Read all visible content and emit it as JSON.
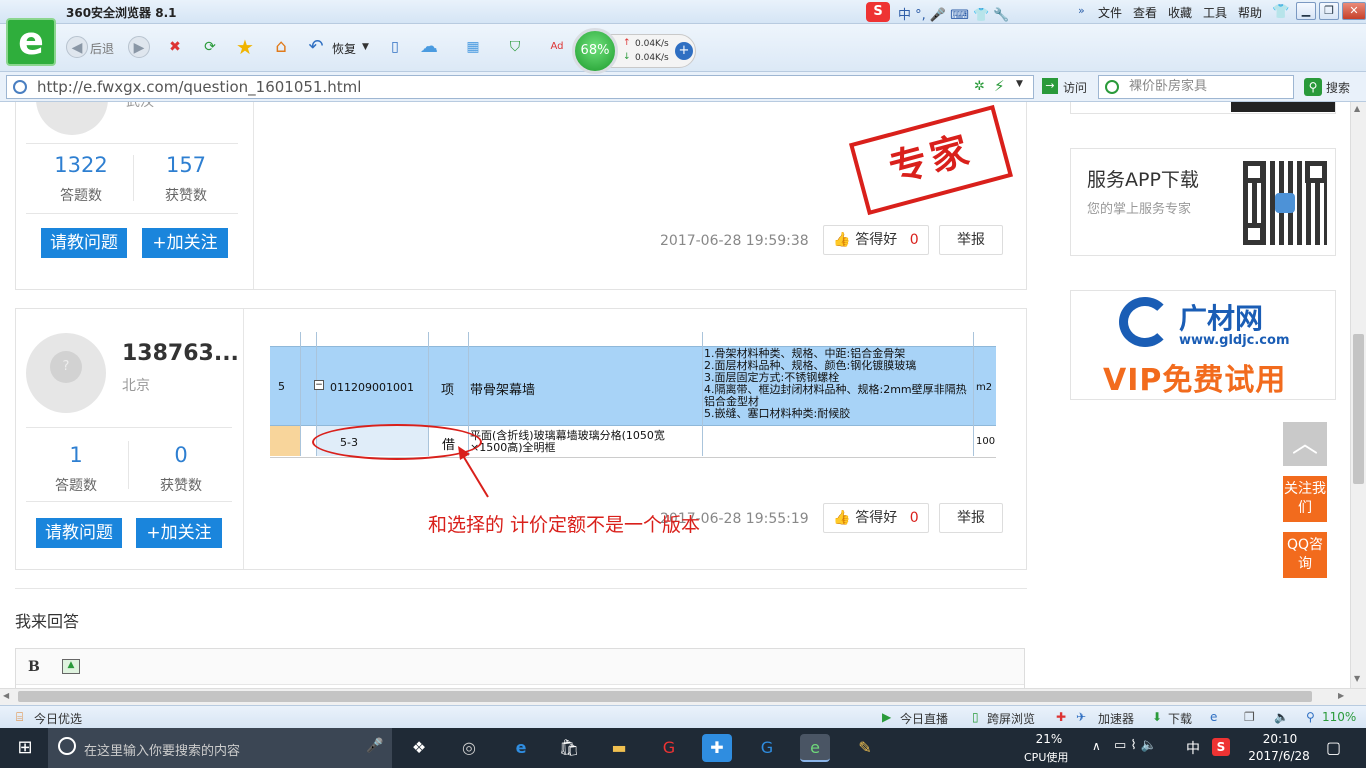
{
  "browser": {
    "title": "360安全浏览器 8.1",
    "menu": [
      "文件",
      "查看",
      "收藏",
      "工具",
      "帮助"
    ],
    "nav": {
      "back": "后退",
      "restore": "恢复"
    },
    "speed": {
      "percent": "68%",
      "up": "0.04K/s",
      "down": "0.04K/s"
    },
    "url": "http://e.fwxgx.com/question_1601051.html",
    "visit_label": "访问",
    "search_placeholder": "裸价卧房家具",
    "search_label": "搜索"
  },
  "answer1": {
    "location": "武汉",
    "answers": "1322",
    "answers_label": "答题数",
    "likes": "157",
    "likes_label": "获赞数",
    "ask_btn": "请教问题",
    "follow_btn": "+加关注",
    "stamp": "专家",
    "time": "2017-06-28 19:59:38",
    "good_label": "答得好",
    "good_count": "0",
    "report_label": "举报"
  },
  "answer2": {
    "user": "138763...",
    "location": "北京",
    "answers": "1",
    "answers_label": "答题数",
    "likes": "0",
    "likes_label": "获赞数",
    "ask_btn": "请教问题",
    "follow_btn": "+加关注",
    "time": "2017-06-28 19:55:19",
    "good_label": "答得好",
    "good_count": "0",
    "report_label": "举报",
    "annotation": "和选择的  计价定额不是一个版本",
    "sheet": {
      "row_no": "5",
      "code": "011209001001",
      "unit_type": "项",
      "name": "带骨架幕墙",
      "desc": [
        "1.骨架材料种类、规格、中距:铝合金骨架",
        "2.面层材料品种、规格、颜色:钢化镀膜玻璃",
        "3.面层固定方式:不锈钢螺栓",
        "4.隔离带、框边封闭材料品种、规格:2mm壁厚非隔热铝合金型材",
        "5.嵌缝、塞口材料种类:耐候胶"
      ],
      "unit": "m2",
      "sub_code": "5-3",
      "sub_type": "借",
      "sub_name": "平面(含折线)玻璃幕墙玻璃分格(1050宽×1500高)全明框",
      "sub_qty": "100"
    }
  },
  "reply": {
    "title": "我来回答",
    "bold": "B"
  },
  "sidebar": {
    "app_title": "服务APP下载",
    "app_sub": "您的掌上服务专家",
    "ad_brand": "广材网",
    "ad_url": "www.gldjc.com",
    "ad_slogan": "VIP免费试用",
    "follow_us": "关注我们",
    "qq": "QQ咨询"
  },
  "statusbar": {
    "today": "今日优选",
    "live": "今日直播",
    "cross": "跨屏浏览",
    "accel": "加速器",
    "download": "下载",
    "zoom": "110%"
  },
  "taskbar": {
    "search_placeholder": "在这里输入你要搜索的内容",
    "cpu": "21%",
    "cpu_label": "CPU使用",
    "ime": "中",
    "time": "20:10",
    "date": "2017/6/28"
  },
  "colors": {
    "accent": "#1a85dc",
    "orange": "#f26b1d",
    "red": "#d9201b"
  }
}
